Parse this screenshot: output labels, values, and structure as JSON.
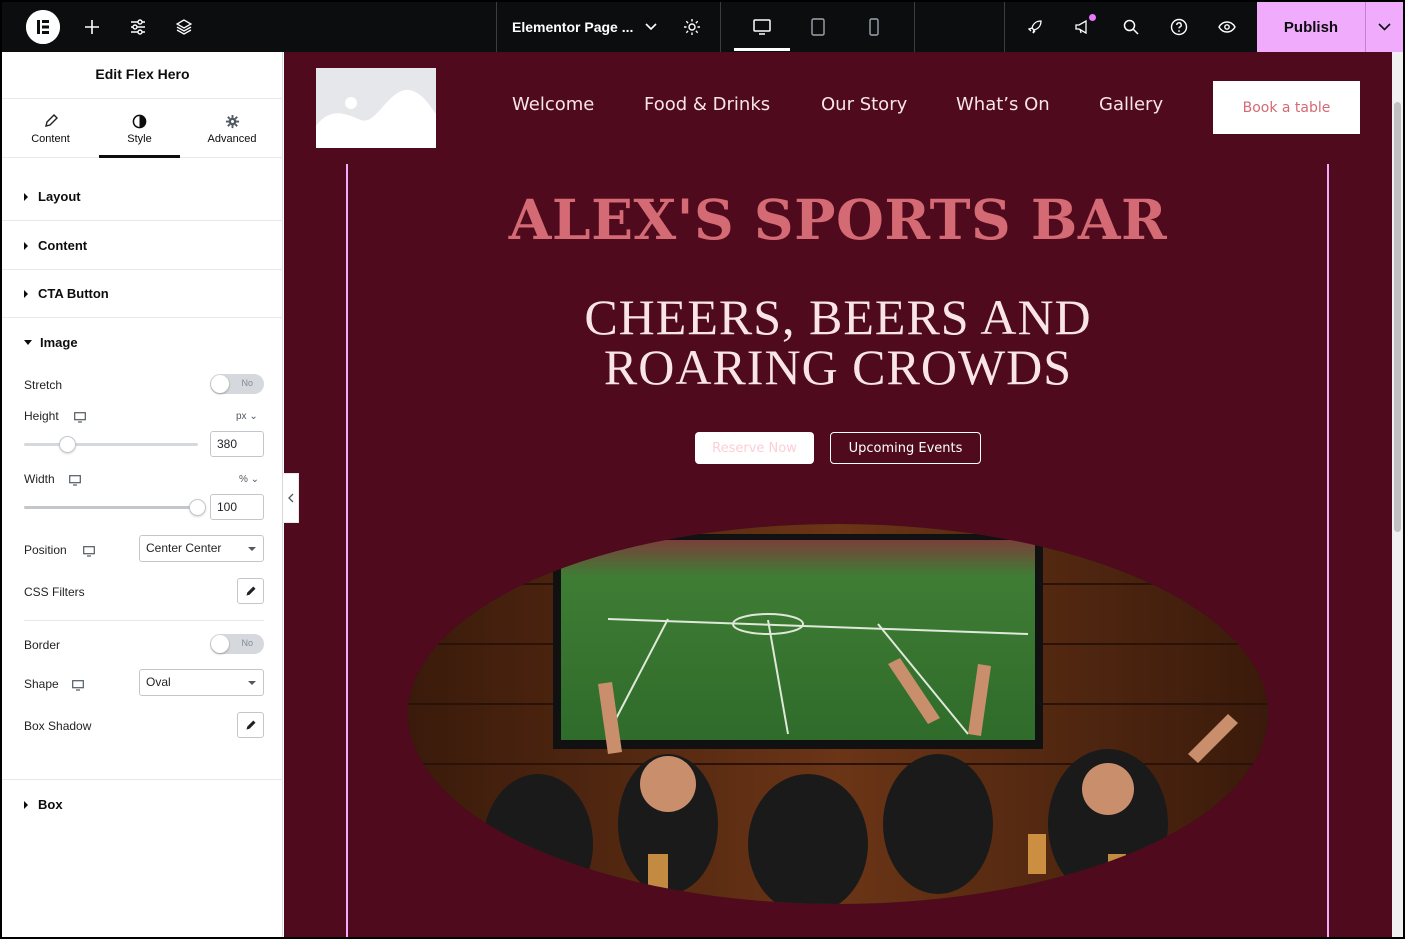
{
  "topbar": {
    "document_title": "Elementor Page ...",
    "publish_label": "Publish"
  },
  "panel": {
    "title": "Edit Flex Hero",
    "tabs": [
      {
        "label": "Content",
        "icon": "pencil-icon"
      },
      {
        "label": "Style",
        "icon": "contrast-icon",
        "active": true
      },
      {
        "label": "Advanced",
        "icon": "gear-icon"
      }
    ],
    "sections": {
      "layout": "Layout",
      "content": "Content",
      "cta": "CTA Button",
      "image": "Image",
      "box": "Box"
    },
    "image_controls": {
      "stretch_label": "Stretch",
      "stretch_value": "No",
      "height_label": "Height",
      "height_unit": "px",
      "height_value": "380",
      "width_label": "Width",
      "width_unit": "%",
      "width_value": "100",
      "position_label": "Position",
      "position_value": "Center Center",
      "css_filters_label": "CSS Filters",
      "border_label": "Border",
      "border_value": "No",
      "shape_label": "Shape",
      "shape_value": "Oval",
      "box_shadow_label": "Box Shadow"
    }
  },
  "preview": {
    "nav": [
      "Welcome",
      "Food & Drinks",
      "Our Story",
      "What’s On",
      "Gallery"
    ],
    "book_button": "Book a table",
    "hero_title": "ALEX'S SPORTS BAR",
    "hero_subtitle_line1": "CHEERS, BEERS AND",
    "hero_subtitle_line2": "ROARING CROWDS",
    "reserve_button": "Reserve Now",
    "events_button": "Upcoming Events"
  },
  "colors": {
    "accent": "#f0abfc",
    "canvas_bg": "#4f0a1d",
    "title": "#d46a73"
  }
}
